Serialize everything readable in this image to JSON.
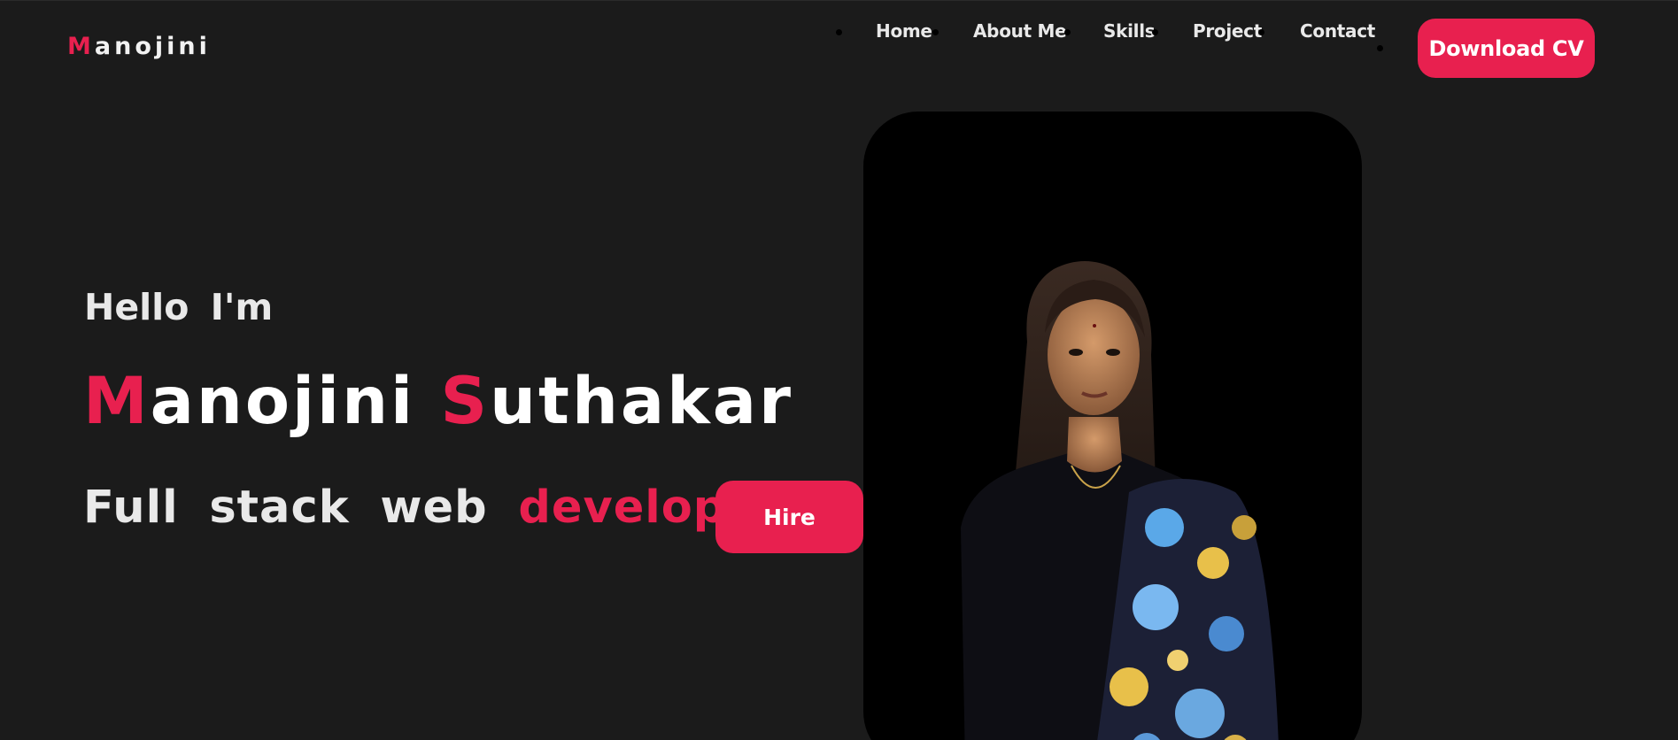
{
  "logo": {
    "first_letter": "M",
    "rest": "anojini"
  },
  "nav": {
    "items": [
      {
        "label": "Home"
      },
      {
        "label": "About Me"
      },
      {
        "label": "Skills"
      },
      {
        "label": "Project"
      },
      {
        "label": "Contact"
      }
    ]
  },
  "header": {
    "download_label": "Download CV"
  },
  "hero": {
    "greeting": "Hello  I'm",
    "first_name_initial": "M",
    "first_name_rest": "anojini",
    "last_name_initial": "S",
    "last_name_rest": "uthakar",
    "role_plain": "Full  stack  web",
    "role_accent": "developer",
    "hire_label": "Hire"
  },
  "colors": {
    "accent": "#e8204f",
    "background": "#1b1b1b",
    "card": "#000000",
    "text": "#f2f2f2"
  }
}
